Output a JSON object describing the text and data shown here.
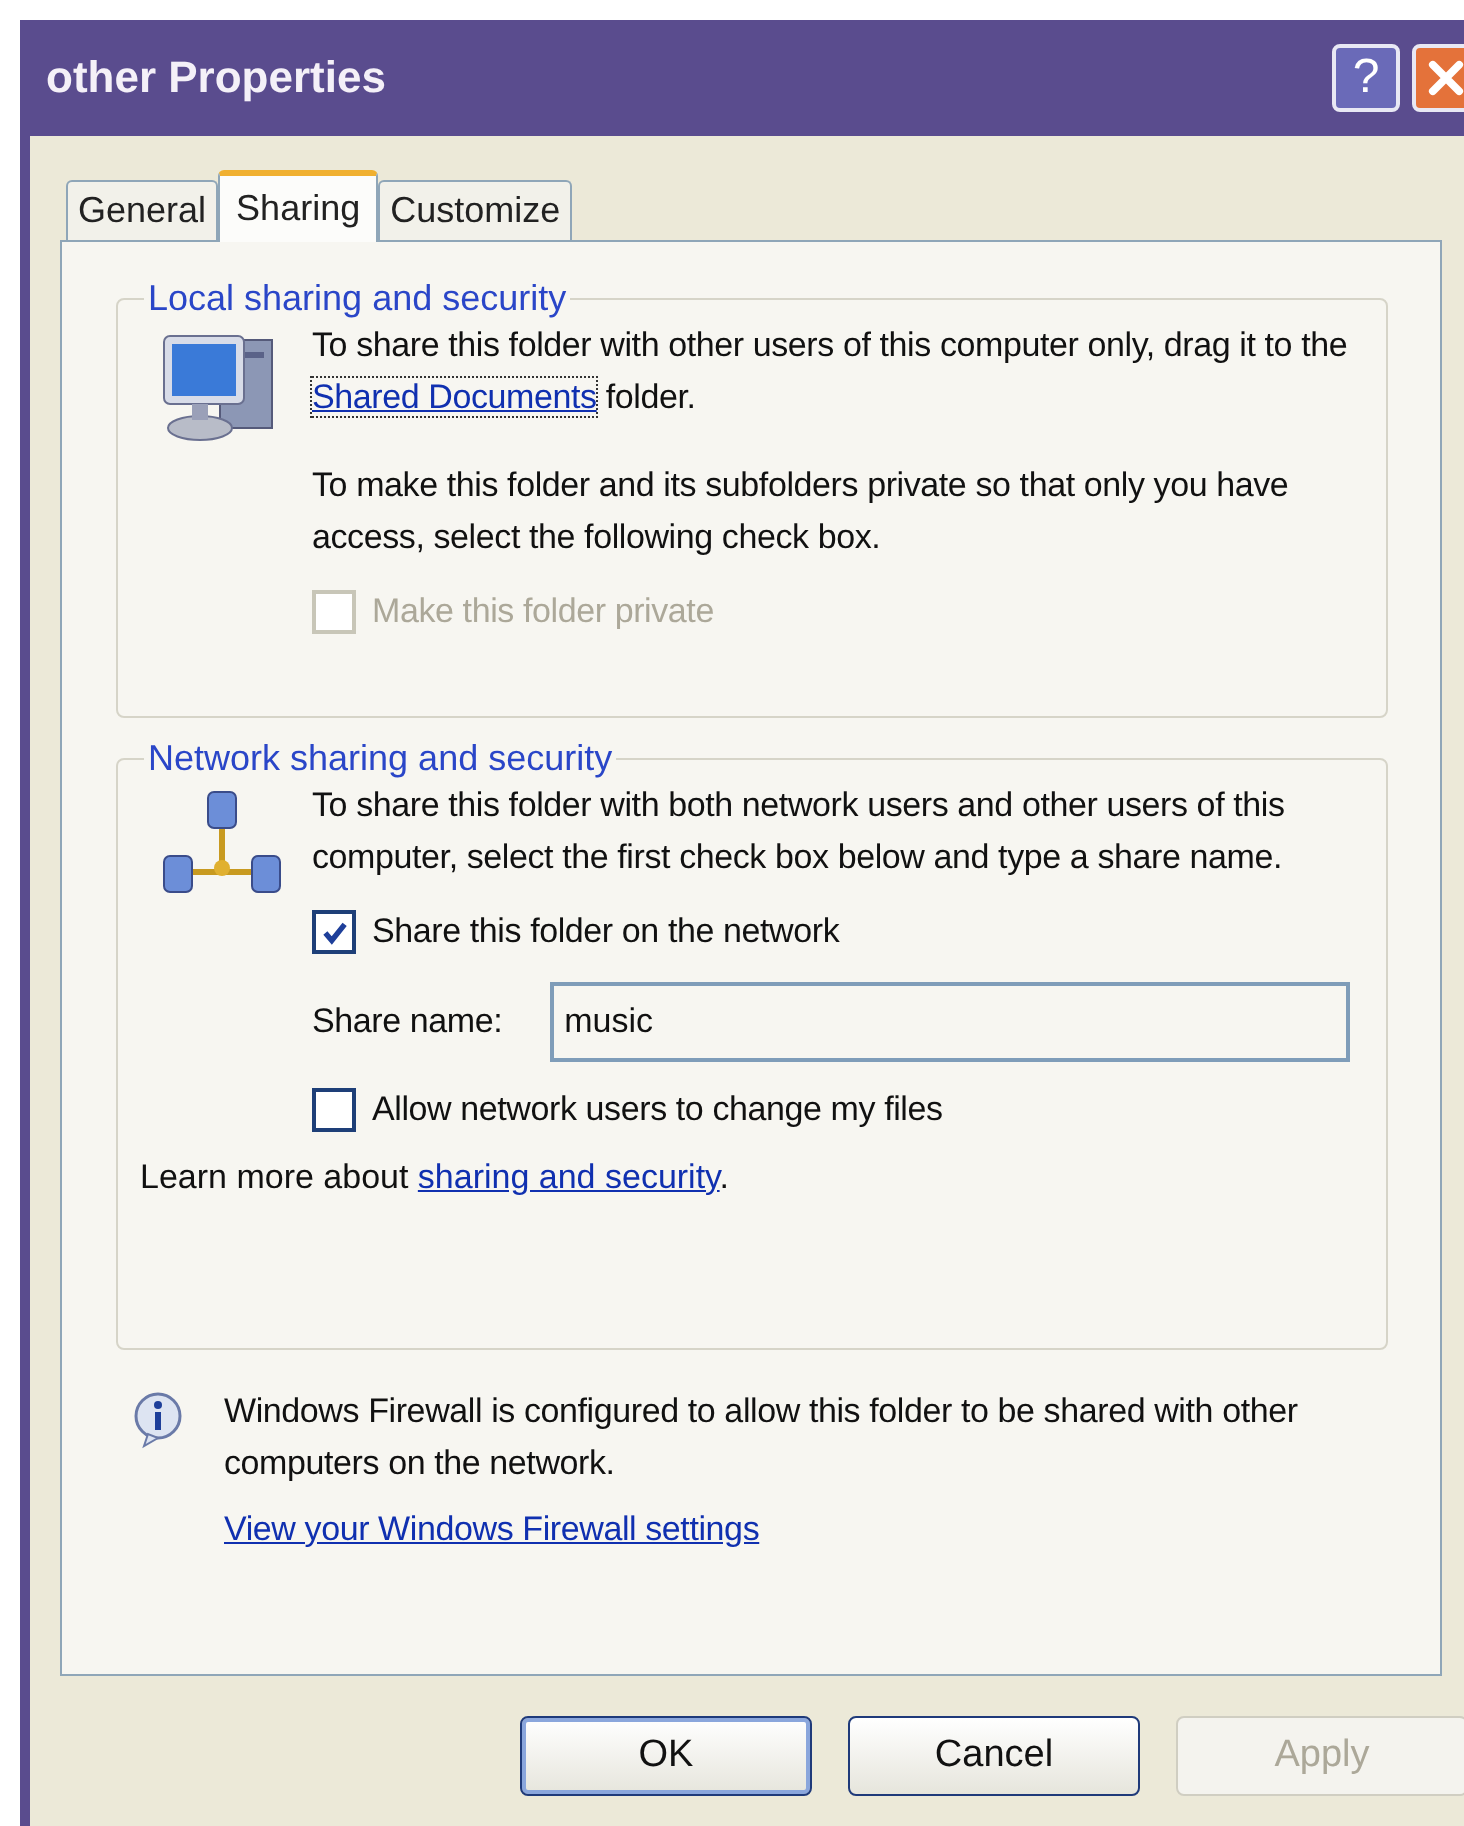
{
  "window": {
    "title": "other Properties",
    "help_button": "?"
  },
  "tabs": [
    {
      "label": "General",
      "selected": false
    },
    {
      "label": "Sharing",
      "selected": true
    },
    {
      "label": "Customize",
      "selected": false
    }
  ],
  "local_group": {
    "legend": "Local sharing and security",
    "text_before": "To share this folder with other users of this computer only, drag it to the ",
    "link": "Shared Documents",
    "text_after": " folder.",
    "text2": "To make this folder and its subfolders private so that only you have access, select the following check box.",
    "checkbox": {
      "label": "Make this folder private",
      "checked": false,
      "disabled": true
    }
  },
  "network_group": {
    "legend": "Network sharing and security",
    "text": "To share this folder with both network users and other users of this computer, select the first check box below and type a share name.",
    "share_checkbox": {
      "label": "Share this folder on the network",
      "checked": true,
      "disabled": false
    },
    "share_name": {
      "label": "Share name:",
      "value": "music"
    },
    "allow_checkbox": {
      "label": "Allow network users to change my files",
      "checked": false,
      "disabled": false
    },
    "learn_more": {
      "text_before": "Learn more about ",
      "link": "sharing and security",
      "text_after": "."
    }
  },
  "firewall": {
    "text": "Windows Firewall is configured to allow this folder to be shared with other computers on the network.",
    "link": "View your Windows Firewall settings"
  },
  "buttons": [
    {
      "label": "OK",
      "disabled": false,
      "default": true
    },
    {
      "label": "Cancel",
      "disabled": false,
      "default": false
    },
    {
      "label": "Apply",
      "disabled": true,
      "default": false
    }
  ]
}
